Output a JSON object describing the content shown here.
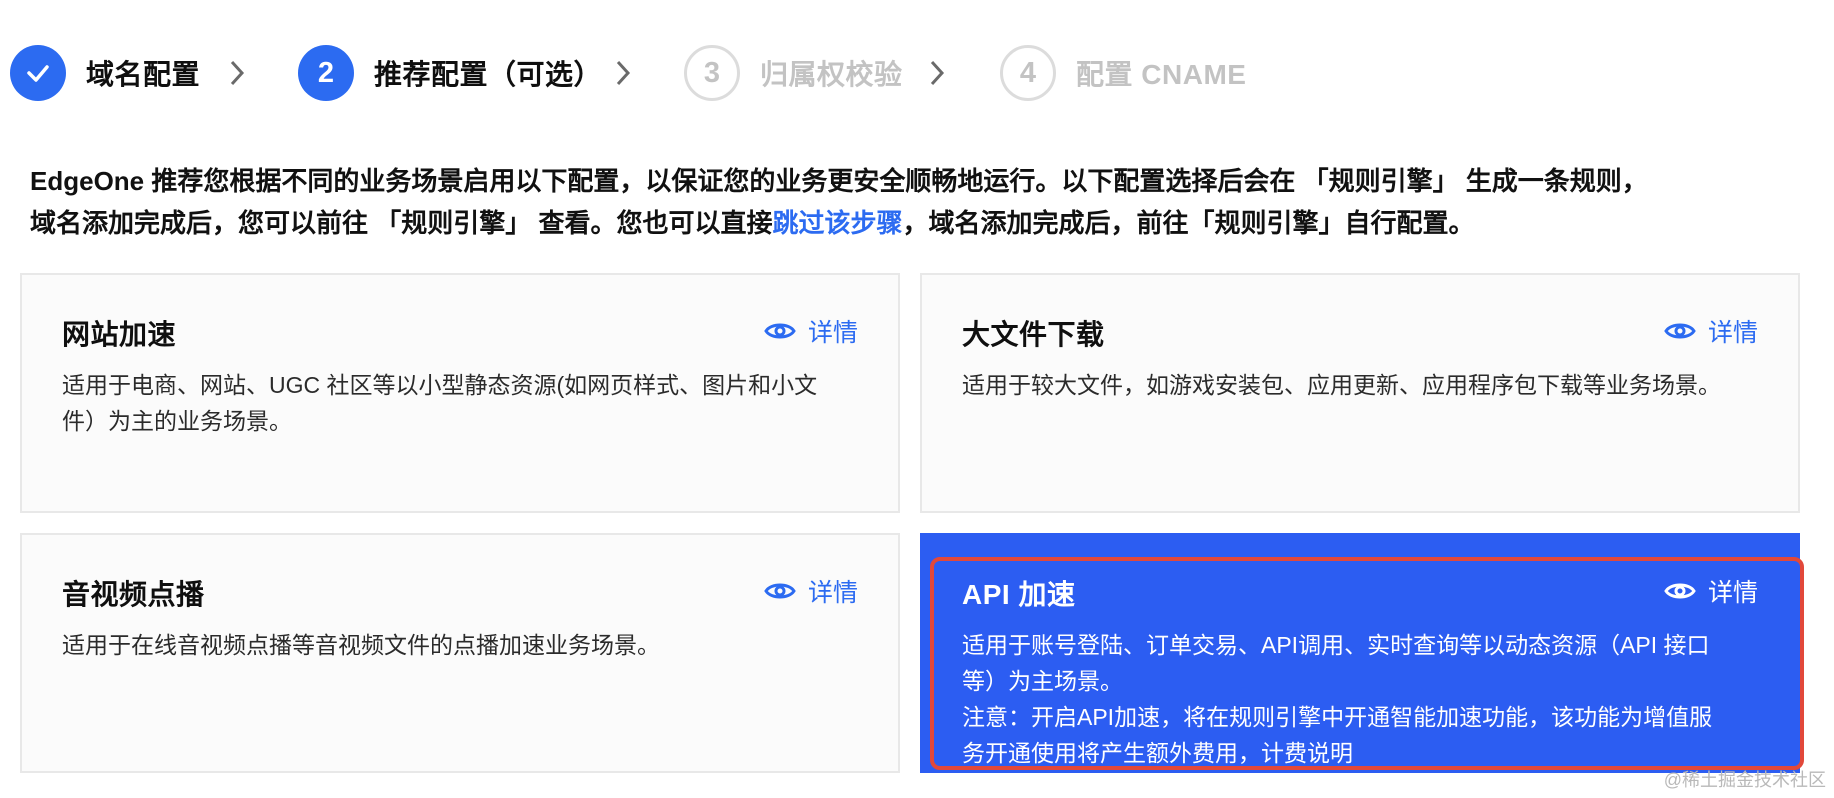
{
  "steps": [
    {
      "number": "✓",
      "label": "域名配置",
      "state": "done"
    },
    {
      "number": "2",
      "label": "推荐配置（可选）",
      "state": "active"
    },
    {
      "number": "3",
      "label": "归属权校验",
      "state": "pending"
    },
    {
      "number": "4",
      "label": "配置 CNAME",
      "state": "pending"
    }
  ],
  "intro": {
    "line1": "EdgeOne 推荐您根据不同的业务场景启用以下配置，以保证您的业务更安全顺畅地运行。以下配置选择后会在 「规则引擎」 生成一条规则，",
    "line2_prefix": "域名添加完成后，您可以前往 「规则引擎」 查看。您也可以直接",
    "link": "跳过该步骤",
    "line2_suffix": "，域名添加完成后，前往「规则引擎」自行配置。"
  },
  "cards": [
    {
      "title": "网站加速",
      "detail": "详情",
      "desc": [
        "适用于电商、网站、UGC 社区等以小型静态资源(如网页样式、图片和小文",
        "件）为主的业务场景。"
      ]
    },
    {
      "title": "大文件下载",
      "detail": "详情",
      "desc": [
        "适用于较大文件，如游戏安装包、应用更新、应用程序包下载等业务场景。"
      ]
    },
    {
      "title": "音视频点播",
      "detail": "详情",
      "desc": [
        "适用于在线音视频点播等音视频文件的点播加速业务场景。"
      ]
    },
    {
      "title": "API 加速",
      "detail": "详情",
      "desc": [
        "适用于账号登陆、订单交易、API调用、实时查询等以动态资源（API 接口",
        "等）为主场景。",
        "注意：开启API加速，将在规则引擎中开通智能加速功能，该功能为增值服",
        "务开通使用将产生额外费用，计费说明"
      ],
      "selected": true
    }
  ],
  "watermark": "@稀土掘金技术社区",
  "colors": {
    "primary": "#2c6bf1",
    "selected_card": "#2c5df2",
    "highlight": "#e2483a",
    "pending": "#c3c3c3"
  }
}
